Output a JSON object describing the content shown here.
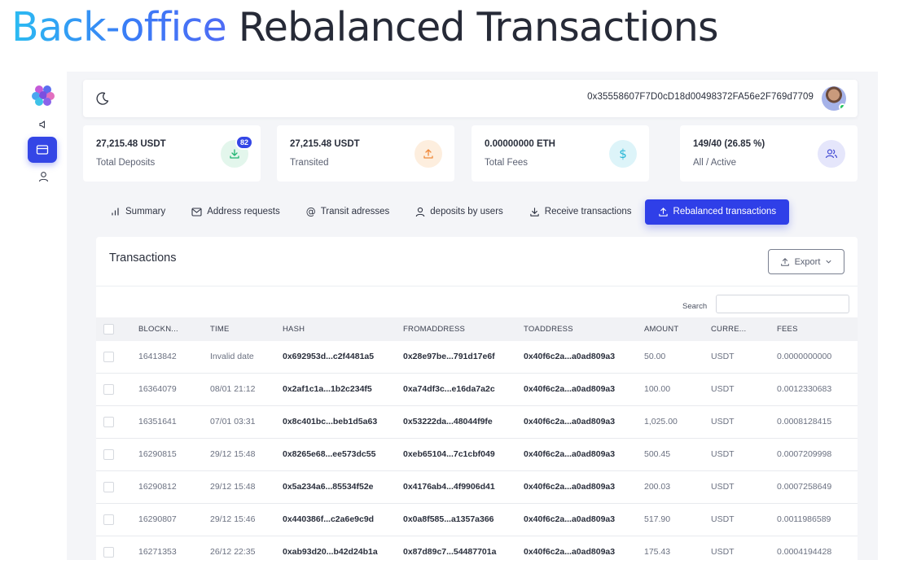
{
  "hero": {
    "accent": "Back-office",
    "rest": "Rebalanced Transactions"
  },
  "topbar": {
    "wallet_address": "0x35558607F7D0cD18d00498372FA56e2F769d7709"
  },
  "stats": [
    {
      "value": "27,215.48 USDT",
      "label": "Total Deposits",
      "icon": "download-icon",
      "badge": "82",
      "color": "#22b573"
    },
    {
      "value": "27,215.48 USDT",
      "label": "Transited",
      "icon": "upload-icon",
      "color": "#f08a3c"
    },
    {
      "value": "0.00000000 ETH",
      "label": "Total Fees",
      "icon": "dollar-icon",
      "color": "#27b6d6"
    },
    {
      "value": "149/40 (26.85 %)",
      "label": "All / Active",
      "icon": "users-icon",
      "color": "#4b52d6"
    }
  ],
  "tabs": [
    {
      "label": "Summary",
      "icon": "chart-icon"
    },
    {
      "label": "Address requests",
      "icon": "mail-icon"
    },
    {
      "label": "Transit adresses",
      "icon": "at-icon"
    },
    {
      "label": "deposits by users",
      "icon": "user-icon"
    },
    {
      "label": "Receive transactions",
      "icon": "download-icon"
    },
    {
      "label": "Rebalanced transactions",
      "icon": "upload-icon",
      "active": true
    }
  ],
  "table": {
    "title": "Transactions",
    "export_label": "Export",
    "search_label": "Search",
    "columns": [
      "BLOCKN...",
      "TIME",
      "HASH",
      "FROMADDRESS",
      "TOADDRESS",
      "AMOUNT",
      "CURRE...",
      "FEES"
    ],
    "rows": [
      [
        "16413842",
        "Invalid date",
        "0x692953d...c2f4481a5",
        "0x28e97be...791d17e6f",
        "0x40f6c2a...a0ad809a3",
        "50.00",
        "USDT",
        "0.0000000000"
      ],
      [
        "16364079",
        "08/01 21:12",
        "0x2af1c1a...1b2c234f5",
        "0xa74df3c...e16da7a2c",
        "0x40f6c2a...a0ad809a3",
        "100.00",
        "USDT",
        "0.0012330683"
      ],
      [
        "16351641",
        "07/01 03:31",
        "0x8c401bc...beb1d5a63",
        "0x53222da...48044f9fe",
        "0x40f6c2a...a0ad809a3",
        "1,025.00",
        "USDT",
        "0.0008128415"
      ],
      [
        "16290815",
        "29/12 15:48",
        "0x8265e68...ee573dc55",
        "0xeb65104...7c1cbf049",
        "0x40f6c2a...a0ad809a3",
        "500.45",
        "USDT",
        "0.0007209998"
      ],
      [
        "16290812",
        "29/12 15:48",
        "0x5a234a6...85534f52e",
        "0x4176ab4...4f9906d41",
        "0x40f6c2a...a0ad809a3",
        "200.03",
        "USDT",
        "0.0007258649"
      ],
      [
        "16290807",
        "29/12 15:46",
        "0x440386f...c2a6e9c9d",
        "0x0a8f585...a1357a366",
        "0x40f6c2a...a0ad809a3",
        "517.90",
        "USDT",
        "0.0011986589"
      ],
      [
        "16271353",
        "26/12 22:35",
        "0xab93d20...b42d24b1a",
        "0x87d89c7...54487701a",
        "0x40f6c2a...a0ad809a3",
        "175.43",
        "USDT",
        "0.0004194428"
      ]
    ]
  }
}
